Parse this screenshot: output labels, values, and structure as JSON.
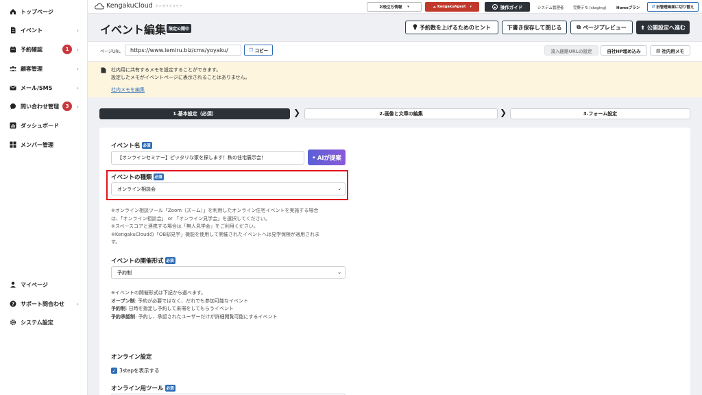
{
  "sidebar": {
    "items": [
      {
        "label": "トップページ",
        "icon": "home-icon"
      },
      {
        "label": "イベント",
        "icon": "document-icon"
      },
      {
        "label": "予約確認",
        "icon": "calendar-icon",
        "badge": "1"
      },
      {
        "label": "顧客管理",
        "icon": "users-icon"
      },
      {
        "label": "メール/SMS",
        "icon": "mail-icon"
      },
      {
        "label": "問い合わせ管理",
        "icon": "chat-icon",
        "badge": "3"
      },
      {
        "label": "ダッシュボード",
        "icon": "chart-icon"
      },
      {
        "label": "メンバー管理",
        "icon": "grid-icon"
      }
    ],
    "bottom_items": [
      {
        "label": "マイページ",
        "icon": "user-icon"
      },
      {
        "label": "サポート問合わせ",
        "icon": "help-icon"
      },
      {
        "label": "システム設定",
        "icon": "gear-icon"
      }
    ]
  },
  "topbar": {
    "logo_text": "KengakuCloud",
    "logo_sub": "ケンガククラウド",
    "info_label": "お役立ち情報",
    "agent_label": "KengakuAgent",
    "guide_label": "操作ガイド",
    "role": "システム管理者",
    "user": "完野デモ (staging)",
    "plan": "Homeプラン",
    "switch_label": "旧管理画面に切り替え"
  },
  "header": {
    "title": "イベント編集",
    "status_badge": "限定公開中",
    "hint_button": "予約数を上げるためのヒント",
    "save_button": "下書き保存して閉じる",
    "preview_button": "ページプレビュー",
    "publish_button": "公開設定へ進む"
  },
  "url_row": {
    "label": "ページURL",
    "url": "https://www.iemiru.biz/cms/yoyaku/",
    "copy_button": "コピー",
    "inflow_button": "流入経路URLの設定",
    "embed_button": "自社HP埋め込み",
    "memo_button": "社内用メモ"
  },
  "memo": {
    "line1": "社内用に共有するメモを設定することができます。",
    "line2": "設定したメモがイベントページに表示されることはありません。",
    "edit_link": "社内メモを編集"
  },
  "steps": [
    {
      "label": "1.基本設定（必須）"
    },
    {
      "label": "2.画像と文章の編集"
    },
    {
      "label": "3.フォーム設定"
    }
  ],
  "form": {
    "required_tag": "必須",
    "event_name_label": "イベント名",
    "event_name_value": "【オンラインセミナー】ピッタリな家を探します！秋の住宅展示会！",
    "ai_button": "AIが提案",
    "event_type_label": "イベントの種類",
    "event_type_value": "オンライン相談会",
    "event_type_notes": [
      "※オンライン相談ツール「Zoom（ズーム）」を利用したオンライン住宅イベントを実施する場合",
      "は、「オンライン相談会」 or 「オンライン見学会」を選択してください。",
      "※スペースコアと連携する場合は「無人見学会」をご利用ください。",
      "※KengakuCloudの「OB邸見学」機能を使用して開催されたイベントへは見学保険が適用されま",
      "す。"
    ],
    "format_label": "イベントの開催形式",
    "format_value": "予約制",
    "format_intro": "※イベントの開催形式は下記から選べます。",
    "format_notes": [
      {
        "term": "オープン制",
        "desc": ": 予約が必要ではなく、だれでも参加可能なイベント"
      },
      {
        "term": "予約制",
        "desc": ": 日時を指定し予約して来場をしてもらうイベント"
      },
      {
        "term": "予約承認制",
        "desc": ": 予約し、承認されたユーザーだけが詳細閲覧可能にするイベント"
      }
    ]
  },
  "online": {
    "section_title": "オンライン設定",
    "checkbox_label": "3stepを表示する",
    "tool_label": "オンライン用ツール"
  },
  "colors": {
    "accent_blue": "#2d6cb5",
    "ai_purple": "#6d5bd0",
    "agent_red": "#c0392b",
    "highlight_red": "#e0141e",
    "memo_bg": "#fdf5de",
    "dark": "#2c3138"
  }
}
